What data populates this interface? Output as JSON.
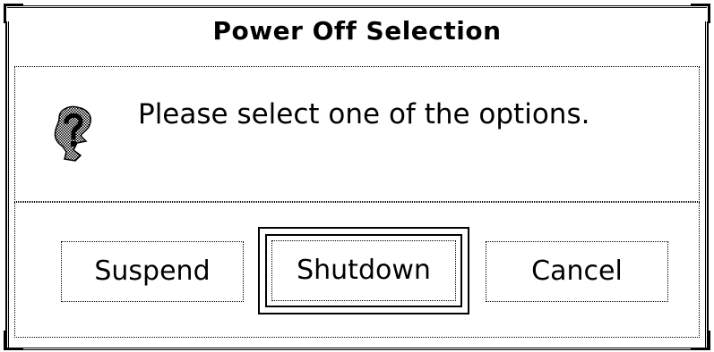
{
  "dialog": {
    "title": "Power Off Selection",
    "message": "Please select one of the options.",
    "icon": "question-help-icon"
  },
  "buttons": {
    "suspend_label": "Suspend",
    "shutdown_label": "Shutdown",
    "cancel_label": "Cancel",
    "default_button": "Shutdown"
  }
}
